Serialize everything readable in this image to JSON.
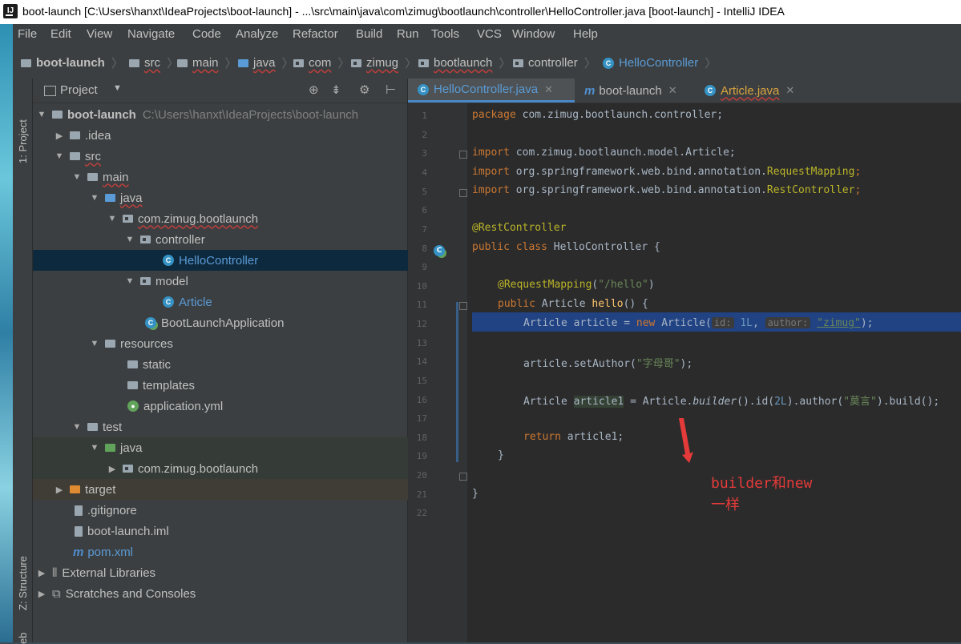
{
  "window": {
    "title": "boot-launch [C:\\Users\\hanxt\\IdeaProjects\\boot-launch] - ...\\src\\main\\java\\com\\zimug\\bootlaunch\\controller\\HelloController.java [boot-launch] - IntelliJ IDEA"
  },
  "menu": [
    "File",
    "Edit",
    "View",
    "Navigate",
    "Code",
    "Analyze",
    "Refactor",
    "Build",
    "Run",
    "Tools",
    "VCS",
    "Window",
    "Help"
  ],
  "breadcrumbs": [
    "boot-launch",
    "src",
    "main",
    "java",
    "com",
    "zimug",
    "bootlaunch",
    "controller",
    "HelloController"
  ],
  "sidestrip": {
    "project_label": "1: Project",
    "structure_label": "Z: Structure",
    "bottom_label": "eb"
  },
  "project_panel": {
    "title": "Project",
    "root_path": "C:\\Users\\hanxt\\IdeaProjects\\boot-launch",
    "tree": [
      {
        "label": "boot-launch",
        "expanded": true
      },
      {
        "label": ".idea",
        "expanded": false
      },
      {
        "label": "src",
        "expanded": true
      },
      {
        "label": "main",
        "expanded": true
      },
      {
        "label": "java",
        "expanded": true
      },
      {
        "label": "com.zimug.bootlaunch",
        "expanded": true
      },
      {
        "label": "controller",
        "expanded": true
      },
      {
        "label": "HelloController",
        "selected": true
      },
      {
        "label": "model",
        "expanded": true
      },
      {
        "label": "Article"
      },
      {
        "label": "BootLaunchApplication"
      },
      {
        "label": "resources",
        "expanded": true
      },
      {
        "label": "static"
      },
      {
        "label": "templates"
      },
      {
        "label": "application.yml"
      },
      {
        "label": "test",
        "expanded": true
      },
      {
        "label": "java",
        "expanded": true
      },
      {
        "label": "com.zimug.bootlaunch",
        "expanded": false
      },
      {
        "label": "target",
        "expanded": false
      },
      {
        "label": ".gitignore"
      },
      {
        "label": "boot-launch.iml"
      },
      {
        "label": "pom.xml"
      },
      {
        "label": "External Libraries",
        "expanded": false
      },
      {
        "label": "Scratches and Consoles",
        "expanded": false
      }
    ]
  },
  "tabs": [
    {
      "label": "HelloController.java",
      "active": true
    },
    {
      "label": "boot-launch",
      "active": false
    },
    {
      "label": "Article.java",
      "active": false
    }
  ],
  "editor": {
    "line_numbers": [
      "1",
      "2",
      "3",
      "4",
      "5",
      "6",
      "7",
      "8",
      "9",
      "10",
      "11",
      "12",
      "13",
      "14",
      "15",
      "16",
      "17",
      "18",
      "19",
      "20",
      "21",
      "22"
    ],
    "hints": {
      "id": "id:",
      "author": "author:"
    },
    "code": {
      "l1_kw": "package",
      "l1_rest": " com.zimug.bootlaunch.controller;",
      "l3_kw": "import",
      "l3_rest": " com.zimug.bootlaunch.model.Article;",
      "l4_kw": "import",
      "l4_rest": " org.springframework.web.bind.annotation.",
      "l4_ann": "RequestMapping",
      "l4_end": ";",
      "l5_kw": "import",
      "l5_rest": " org.springframework.web.bind.annotation.",
      "l5_ann": "RestController",
      "l5_end": ";",
      "l7_ann": "@RestController",
      "l8_kw": "public class",
      "l8_rest": " HelloController {",
      "l10_ann": "@RequestMapping",
      "l10_open": "(",
      "l10_str": "\"/hello\"",
      "l10_close": ")",
      "l11_kw": "public",
      "l11_rest": " Article ",
      "l11_name": "hello",
      "l11_end": "() {",
      "l12_a": "Article article = ",
      "l12_kw": "new",
      "l12_b": " Article(",
      "l12_num": "1L",
      "l12_comma": ", ",
      "l12_str": "\"zimug\"",
      "l12_end": ");",
      "l14_a": "article.setAuthor(",
      "l14_str": "\"字母哥\"",
      "l14_end": ");",
      "l16_a": "Article ",
      "l16_var": "article1",
      "l16_b": " = Article.",
      "l16_it": "builder",
      "l16_c": "().id(",
      "l16_num": "2L",
      "l16_d": ").author(",
      "l16_str": "\"莫言\"",
      "l16_e": ").build();",
      "l18_kw": "return",
      "l18_rest": " article1;",
      "l19": "}",
      "l21": "}"
    }
  },
  "annotation": {
    "text": "builder和new\n一样",
    "color": "#e53a3a"
  }
}
